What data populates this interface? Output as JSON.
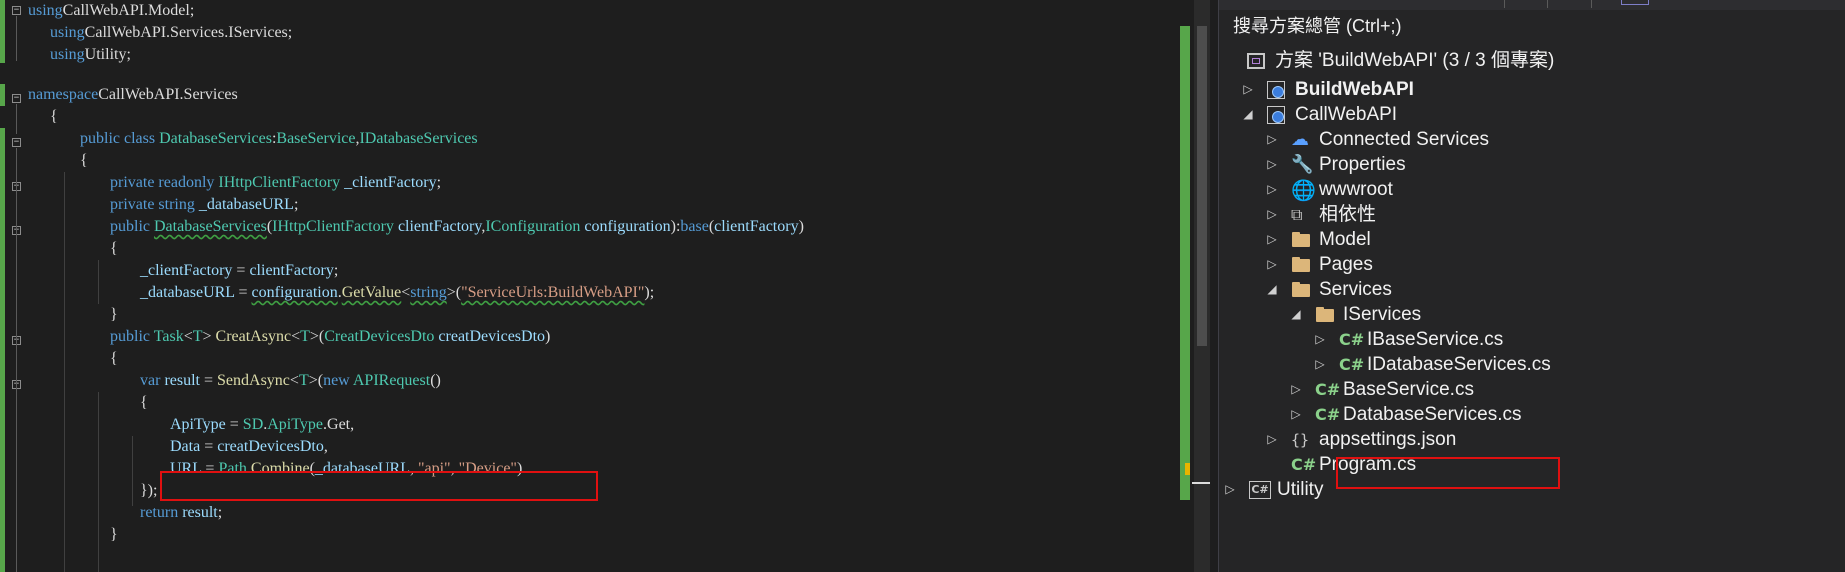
{
  "editor": {
    "lines": [
      [
        [
          "kw",
          "using"
        ],
        [
          "",
          "CallWebAPI.Model;"
        ]
      ],
      [
        [
          "kw",
          "using"
        ],
        [
          "",
          "CallWebAPI.Services.IServices;"
        ]
      ],
      [
        [
          "kw",
          "using"
        ],
        [
          "",
          "Utility;"
        ]
      ],
      [],
      [
        [
          "kw",
          "namespace"
        ],
        [
          "",
          "CallWebAPI.Services"
        ]
      ],
      [
        [
          "",
          "{"
        ]
      ],
      [
        [
          "kw",
          "public class "
        ],
        [
          "ty",
          "DatabaseServices"
        ],
        [
          "",
          ":"
        ],
        [
          "ty",
          "BaseService"
        ],
        [
          "",
          ","
        ],
        [
          "ty",
          "IDatabaseServices"
        ]
      ],
      [
        [
          "",
          "{"
        ]
      ],
      [
        [
          "kw",
          "private readonly "
        ],
        [
          "ty",
          "IHttpClientFactory"
        ],
        [
          "",
          " "
        ],
        [
          "pa",
          "_clientFactory"
        ],
        [
          "",
          ";"
        ]
      ],
      [
        [
          "kw",
          "private string "
        ],
        [
          "pa",
          "_databaseURL"
        ],
        [
          "",
          ";"
        ]
      ],
      [
        [
          "kw",
          "public "
        ],
        [
          "ty",
          "DatabaseServices"
        ],
        [
          "",
          "("
        ],
        [
          "ty",
          "IHttpClientFactory"
        ],
        [
          "",
          " "
        ],
        [
          "pa",
          "clientFactory"
        ],
        [
          "",
          ","
        ],
        [
          "ty",
          "IConfiguration"
        ],
        [
          "",
          " "
        ],
        [
          "pa",
          "configuration"
        ],
        [
          "",
          "):"
        ],
        [
          "kw",
          "base"
        ],
        [
          "",
          "("
        ],
        [
          "pa",
          "clientFactory"
        ],
        [
          "",
          ")"
        ]
      ],
      [
        [
          "",
          "{"
        ]
      ],
      [
        [
          "pa",
          "_clientFactory"
        ],
        [
          "",
          " = "
        ],
        [
          "pa",
          "clientFactory"
        ],
        [
          "",
          ";"
        ]
      ],
      [
        [
          "pa",
          "_databaseURL"
        ],
        [
          "",
          " = "
        ],
        [
          "pa",
          "configuration"
        ],
        [
          "",
          "."
        ],
        [
          "fn",
          "GetValue"
        ],
        [
          "",
          "<"
        ],
        [
          "kw",
          "string"
        ],
        [
          "",
          ">("
        ],
        [
          "st",
          "\"ServiceUrls:BuildWebAPI\""
        ],
        [
          "",
          ");"
        ]
      ],
      [
        [
          "",
          "}"
        ]
      ],
      [
        [
          "kw",
          "public "
        ],
        [
          "ty",
          "Task"
        ],
        [
          "",
          "<"
        ],
        [
          "ty",
          "T"
        ],
        [
          "",
          "> "
        ],
        [
          "fn",
          "CreatAsync"
        ],
        [
          "",
          "<"
        ],
        [
          "ty",
          "T"
        ],
        [
          "",
          ">("
        ],
        [
          "ty",
          "CreatDevicesDto"
        ],
        [
          "",
          " "
        ],
        [
          "pa",
          "creatDevicesDto"
        ],
        [
          "",
          ")"
        ]
      ],
      [
        [
          "",
          "{"
        ]
      ],
      [
        [
          "kw",
          "var "
        ],
        [
          "pa",
          "result"
        ],
        [
          "",
          " = "
        ],
        [
          "fn",
          "SendAsync"
        ],
        [
          "",
          "<"
        ],
        [
          "ty",
          "T"
        ],
        [
          "",
          ">("
        ],
        [
          "kw",
          "new "
        ],
        [
          "ty",
          "APIRequest"
        ],
        [
          "",
          "()"
        ]
      ],
      [
        [
          "",
          "{"
        ]
      ],
      [
        [
          "pa",
          "ApiType"
        ],
        [
          "",
          " = "
        ],
        [
          "ty",
          "SD"
        ],
        [
          "",
          "."
        ],
        [
          "ty",
          "ApiType"
        ],
        [
          "",
          ".Get,"
        ]
      ],
      [
        [
          "pa",
          "Data"
        ],
        [
          "",
          " = "
        ],
        [
          "pa",
          "creatDevicesDto"
        ],
        [
          "",
          ","
        ]
      ],
      [
        [
          "pa",
          "URL"
        ],
        [
          "",
          " = "
        ],
        [
          "ty",
          "Path"
        ],
        [
          "",
          "."
        ],
        [
          "fn",
          "Combine"
        ],
        [
          "",
          "("
        ],
        [
          "pa",
          "_databaseURL"
        ],
        [
          "",
          ", "
        ],
        [
          "st",
          "\"api\""
        ],
        [
          "",
          ", "
        ],
        [
          "st",
          "\"Device\""
        ],
        [
          "",
          ")"
        ]
      ],
      [
        [
          "",
          "});"
        ]
      ],
      [
        [
          "kw",
          "return "
        ],
        [
          "pa",
          "result"
        ],
        [
          "",
          ";"
        ]
      ],
      [
        [
          "",
          "}"
        ]
      ]
    ]
  },
  "solution_explorer": {
    "search": "搜尋方案總管 (Ctrl+;)",
    "solution": "方案 'BuildWebAPI' (3 / 3 個專案)",
    "items": [
      {
        "label": "BuildWebAPI",
        "icon": "web-project-icon"
      },
      {
        "label": "CallWebAPI",
        "icon": "web-project-icon"
      },
      {
        "label": "Connected Services",
        "icon": "connected-services-icon"
      },
      {
        "label": "Properties",
        "icon": "wrench-icon"
      },
      {
        "label": "wwwroot",
        "icon": "globe-icon"
      },
      {
        "label": "相依性",
        "icon": "dependencies-icon"
      },
      {
        "label": "Model",
        "icon": "folder-icon"
      },
      {
        "label": "Pages",
        "icon": "folder-icon"
      },
      {
        "label": "Services",
        "icon": "folder-icon"
      },
      {
        "label": "IServices",
        "icon": "folder-icon"
      },
      {
        "label": "IBaseService.cs",
        "icon": "csharp-file-icon"
      },
      {
        "label": "IDatabaseServices.cs",
        "icon": "csharp-file-icon"
      },
      {
        "label": "BaseService.cs",
        "icon": "csharp-file-icon"
      },
      {
        "label": "DatabaseServices.cs",
        "icon": "csharp-file-icon"
      },
      {
        "label": "appsettings.json",
        "icon": "json-file-icon"
      },
      {
        "label": "Program.cs",
        "icon": "csharp-file-icon"
      },
      {
        "label": "Utility",
        "icon": "class-library-icon"
      }
    ]
  }
}
